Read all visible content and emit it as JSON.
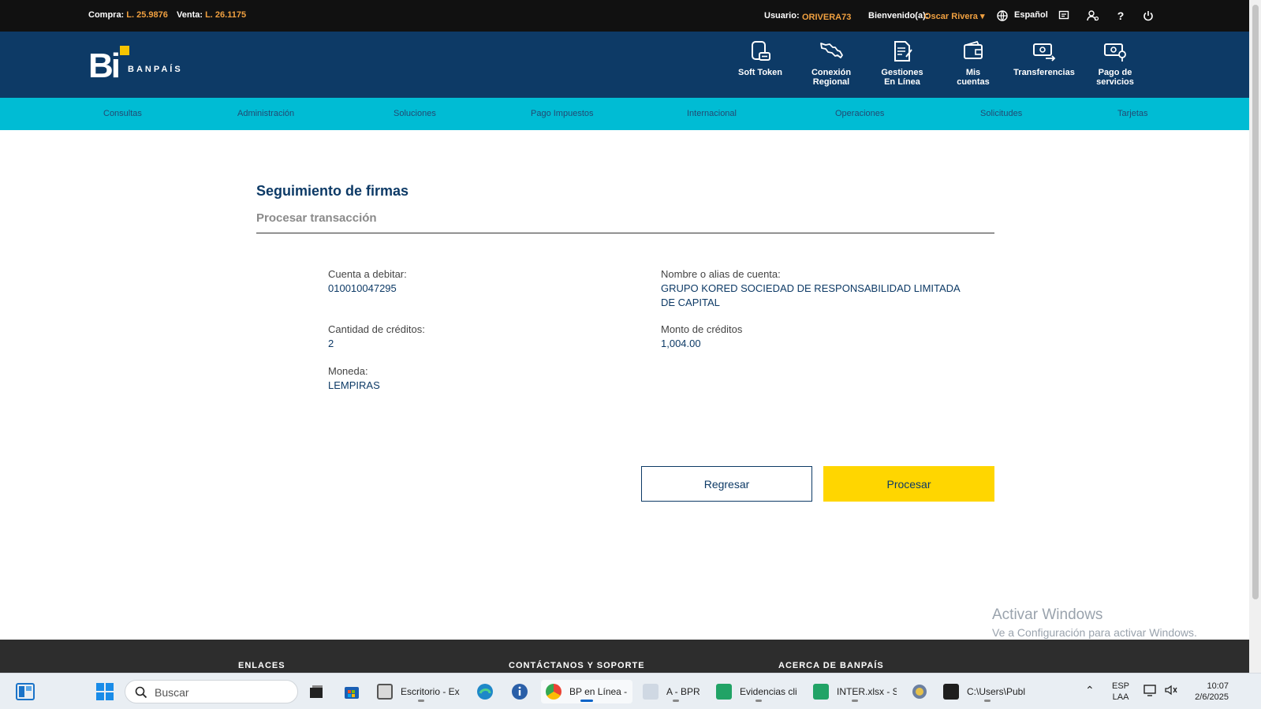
{
  "topbar": {
    "compra_label": "Compra:",
    "compra_value": "L. 25.9876",
    "venta_label": "Venta:",
    "venta_value": "L. 26.1175",
    "usuario_label": "Usuario:",
    "usuario_value": "ORIVERA73",
    "bienvenido_label": "Bienvenido(a):",
    "bienvenido_value": "Oscar Rivera",
    "language": "Español"
  },
  "brand": {
    "logo": "Bi",
    "name": "BANPAÍS"
  },
  "header_nav": [
    {
      "label_1": "Soft Token",
      "label_2": ""
    },
    {
      "label_1": "Conexión",
      "label_2": "Regional"
    },
    {
      "label_1": "Gestiones",
      "label_2": "En Línea"
    },
    {
      "label_1": "Mis",
      "label_2": "cuentas"
    },
    {
      "label_1": "Transferencias",
      "label_2": ""
    },
    {
      "label_1": "Pago de",
      "label_2": "servicios"
    }
  ],
  "menu": [
    "Consultas",
    "Administración",
    "Soluciones",
    "Pago Impuestos",
    "Internacional",
    "Operaciones",
    "Solicitudes",
    "Tarjetas"
  ],
  "page": {
    "title": "Seguimiento de firmas",
    "subtitle": "Procesar transacción"
  },
  "details": {
    "cuenta_label": "Cuenta a debitar:",
    "cuenta_value": "010010047295",
    "nombre_label": "Nombre o alias de cuenta:",
    "nombre_value_1": "GRUPO KORED SOCIEDAD DE RESPONSABILIDAD LIMITADA",
    "nombre_value_2": "DE CAPITAL",
    "cantidad_label": "Cantidad de créditos:",
    "cantidad_value": "2",
    "monto_label": "Monto de créditos",
    "monto_value": "1,004.00",
    "moneda_label": "Moneda:",
    "moneda_value": "LEMPIRAS"
  },
  "buttons": {
    "back": "Regresar",
    "process": "Procesar"
  },
  "watermark": {
    "line1": "Activar Windows",
    "line2": "Ve a Configuración para activar Windows."
  },
  "footer": {
    "col1": "ENLACES",
    "col2": "CONTÁCTANOS Y SOPORTE",
    "col3": "ACERCA DE BANPAÍS"
  },
  "taskbar": {
    "search_placeholder": "Buscar",
    "apps": [
      "Escritorio - Ex",
      "BP en Línea -",
      "A - BPR",
      "Evidencias cli",
      "INTER.xlsx - S",
      "C:\\Users\\Publ"
    ],
    "lang_1": "ESP",
    "lang_2": "LAA",
    "time": "10:07",
    "date": "2/6/2025"
  },
  "colors": {
    "navy": "#0d3a66",
    "cyan": "#00bcd4",
    "yellow": "#ffd600",
    "orange": "#f0a040"
  }
}
